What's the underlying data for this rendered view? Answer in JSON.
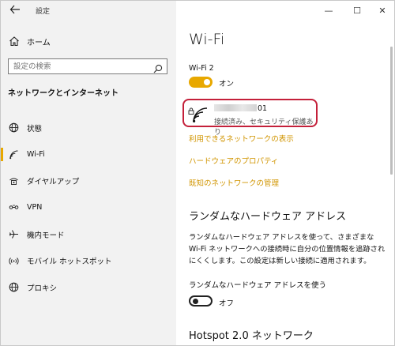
{
  "window": {
    "title": "設定",
    "controls": {
      "minimize": "—",
      "maximize": "☐",
      "close": "✕"
    }
  },
  "sidebar": {
    "home_label": "ホーム",
    "search_placeholder": "設定の検索",
    "section_title": "ネットワークとインターネット",
    "items": [
      {
        "label": "状態",
        "icon": "globe-icon",
        "active": false
      },
      {
        "label": "Wi-Fi",
        "icon": "wifi-icon",
        "active": true
      },
      {
        "label": "ダイヤルアップ",
        "icon": "dialup-icon",
        "active": false
      },
      {
        "label": "VPN",
        "icon": "vpn-icon",
        "active": false
      },
      {
        "label": "機内モード",
        "icon": "airplane-icon",
        "active": false
      },
      {
        "label": "モバイル ホットスポット",
        "icon": "hotspot-icon",
        "active": false
      },
      {
        "label": "プロキシ",
        "icon": "globe-icon",
        "active": false
      }
    ]
  },
  "main": {
    "title": "Wi-Fi",
    "wifi_adapter_label": "Wi-Fi 2",
    "wifi_toggle_state": "オン",
    "network": {
      "name_suffix": "01",
      "status": "接続済み、セキュリティ保護あり"
    },
    "links": {
      "show_networks": "利用できるネットワークの表示",
      "hardware_props": "ハードウェアのプロパティ",
      "manage_known": "既知のネットワークの管理"
    },
    "random_hw": {
      "heading": "ランダムなハードウェア アドレス",
      "description": "ランダムなハードウェア アドレスを使って、さまざまな Wi-Fi ネットワークへの接続時に自分の位置情報を追跡されにくくします。この設定は新しい接続に適用されます。",
      "option_label": "ランダムなハードウェア アドレスを使う",
      "toggle_state": "オフ"
    },
    "hotspot_heading": "Hotspot 2.0 ネットワーク"
  },
  "colors": {
    "accent": "#e8a800",
    "link": "#d19500",
    "highlight_border": "#c4203a",
    "sidebar_bg": "#f2f2f2"
  }
}
